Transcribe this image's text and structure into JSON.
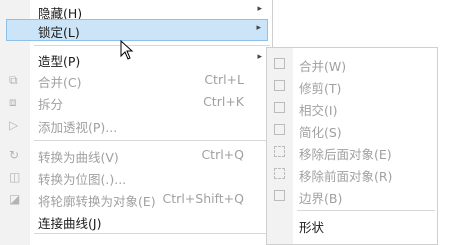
{
  "main_menu": {
    "items": [
      {
        "label": "隐藏(H)",
        "arrow": "▸"
      },
      {
        "label": "锁定(L)",
        "arrow": "▸"
      },
      {
        "label": "造型(P)",
        "arrow": "▸"
      },
      {
        "label": "合并(C)",
        "shortcut": "Ctrl+L"
      },
      {
        "label": "拆分",
        "shortcut": "Ctrl+K"
      },
      {
        "label": "添加透视(P)..."
      },
      {
        "label": "转换为曲线(V)",
        "shortcut": "Ctrl+Q"
      },
      {
        "label": "转换为位图(.)..."
      },
      {
        "label": "将轮廓转换为对象(E)",
        "shortcut": "Ctrl+Shift+Q"
      },
      {
        "label": "连接曲线(J)"
      },
      {
        "label": "..."
      }
    ]
  },
  "submenu": {
    "items": [
      {
        "label": "合并(W)"
      },
      {
        "label": "修剪(T)"
      },
      {
        "label": "相交(I)"
      },
      {
        "label": "简化(S)"
      },
      {
        "label": "移除后面对象(E)"
      },
      {
        "label": "移除前面对象(R)"
      },
      {
        "label": "边界(B)"
      },
      {
        "label": "形状"
      }
    ]
  },
  "colors": {
    "highlight_bg": "#cce4f7",
    "highlight_border": "#8fc0ea",
    "disabled_text": "#a0a0a0"
  }
}
